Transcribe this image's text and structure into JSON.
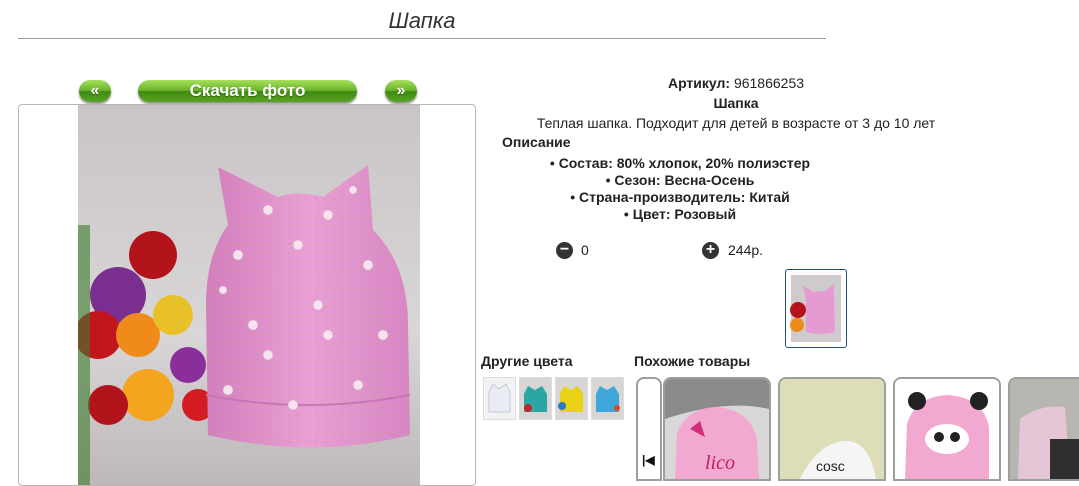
{
  "page": {
    "title": "Шапка"
  },
  "photo_nav": {
    "prev_label": "«",
    "download_label": "Скачать фото",
    "next_label": "»"
  },
  "product": {
    "article_label": "Артикул:",
    "article_value": "961866253",
    "name": "Шапка",
    "description": "Теплая шапка. Подходит для детей в возрасте от 3 до 10 лет",
    "description_heading": "Описание",
    "features": [
      "Состав: 80% хлопок, 20% полиэстер",
      "Сезон: Весна-Осень",
      "Страна-производитель: Китай",
      "Цвет: Розовый"
    ],
    "quantity": "0",
    "price": "244р."
  },
  "icons": {
    "minus": "minus-circle-icon",
    "plus": "plus-circle-icon",
    "carousel_prev": "skip-back-icon"
  },
  "sections": {
    "other_colors": "Другие цвета",
    "similar_products": "Похожие товары"
  },
  "colors": {
    "hat_pink": "#e69ad2",
    "btn_green": "#5aa322",
    "frame_blue": "#1f4f86"
  }
}
